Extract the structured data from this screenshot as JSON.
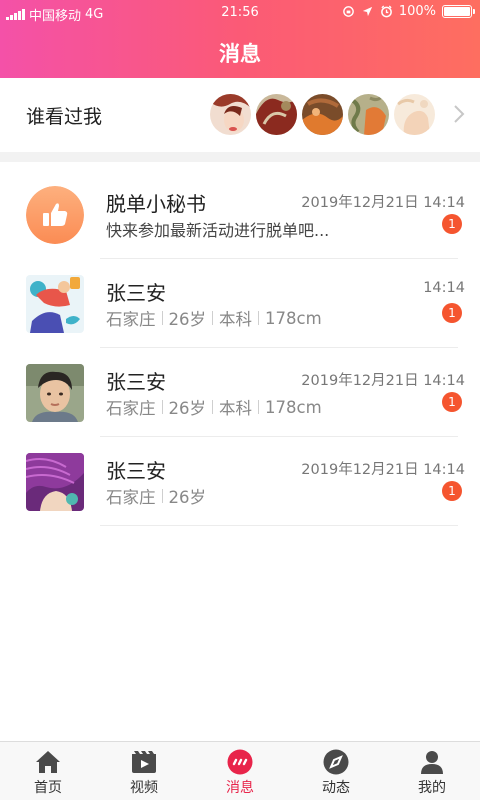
{
  "status_bar": {
    "carrier": "中国移动",
    "network": "4G",
    "time": "21:56",
    "battery": "100%"
  },
  "header": {
    "title": "消息",
    "gradient_colors": [
      "#f451a8",
      "#fb5a76",
      "#fe6e60"
    ]
  },
  "viewers": {
    "label": "谁看过我",
    "avatar_count": 5
  },
  "messages": [
    {
      "name": "脱单小秘书",
      "time": "2019年12月21日 14:14",
      "preview": "快来参加最新活动进行脱单吧...",
      "badge": "1",
      "avatar_icon": "thumbs-up-icon"
    },
    {
      "name": "张三安",
      "time": "14:14",
      "details": [
        "石家庄",
        "26岁",
        "本科",
        "178cm"
      ],
      "badge": "1"
    },
    {
      "name": "张三安",
      "time": "2019年12月21日 14:14",
      "details": [
        "石家庄",
        "26岁",
        "本科",
        "178cm"
      ],
      "badge": "1"
    },
    {
      "name": "张三安",
      "time": "2019年12月21日 14:14",
      "details": [
        "石家庄",
        "26岁"
      ],
      "badge": "1"
    }
  ],
  "tabbar": {
    "tabs": [
      {
        "label": "首页",
        "icon": "home-icon"
      },
      {
        "label": "视频",
        "icon": "video-icon"
      },
      {
        "label": "消息",
        "icon": "message-icon",
        "active": true
      },
      {
        "label": "动态",
        "icon": "compass-icon"
      },
      {
        "label": "我的",
        "icon": "profile-icon"
      }
    ],
    "active_color": "#e8244a"
  }
}
